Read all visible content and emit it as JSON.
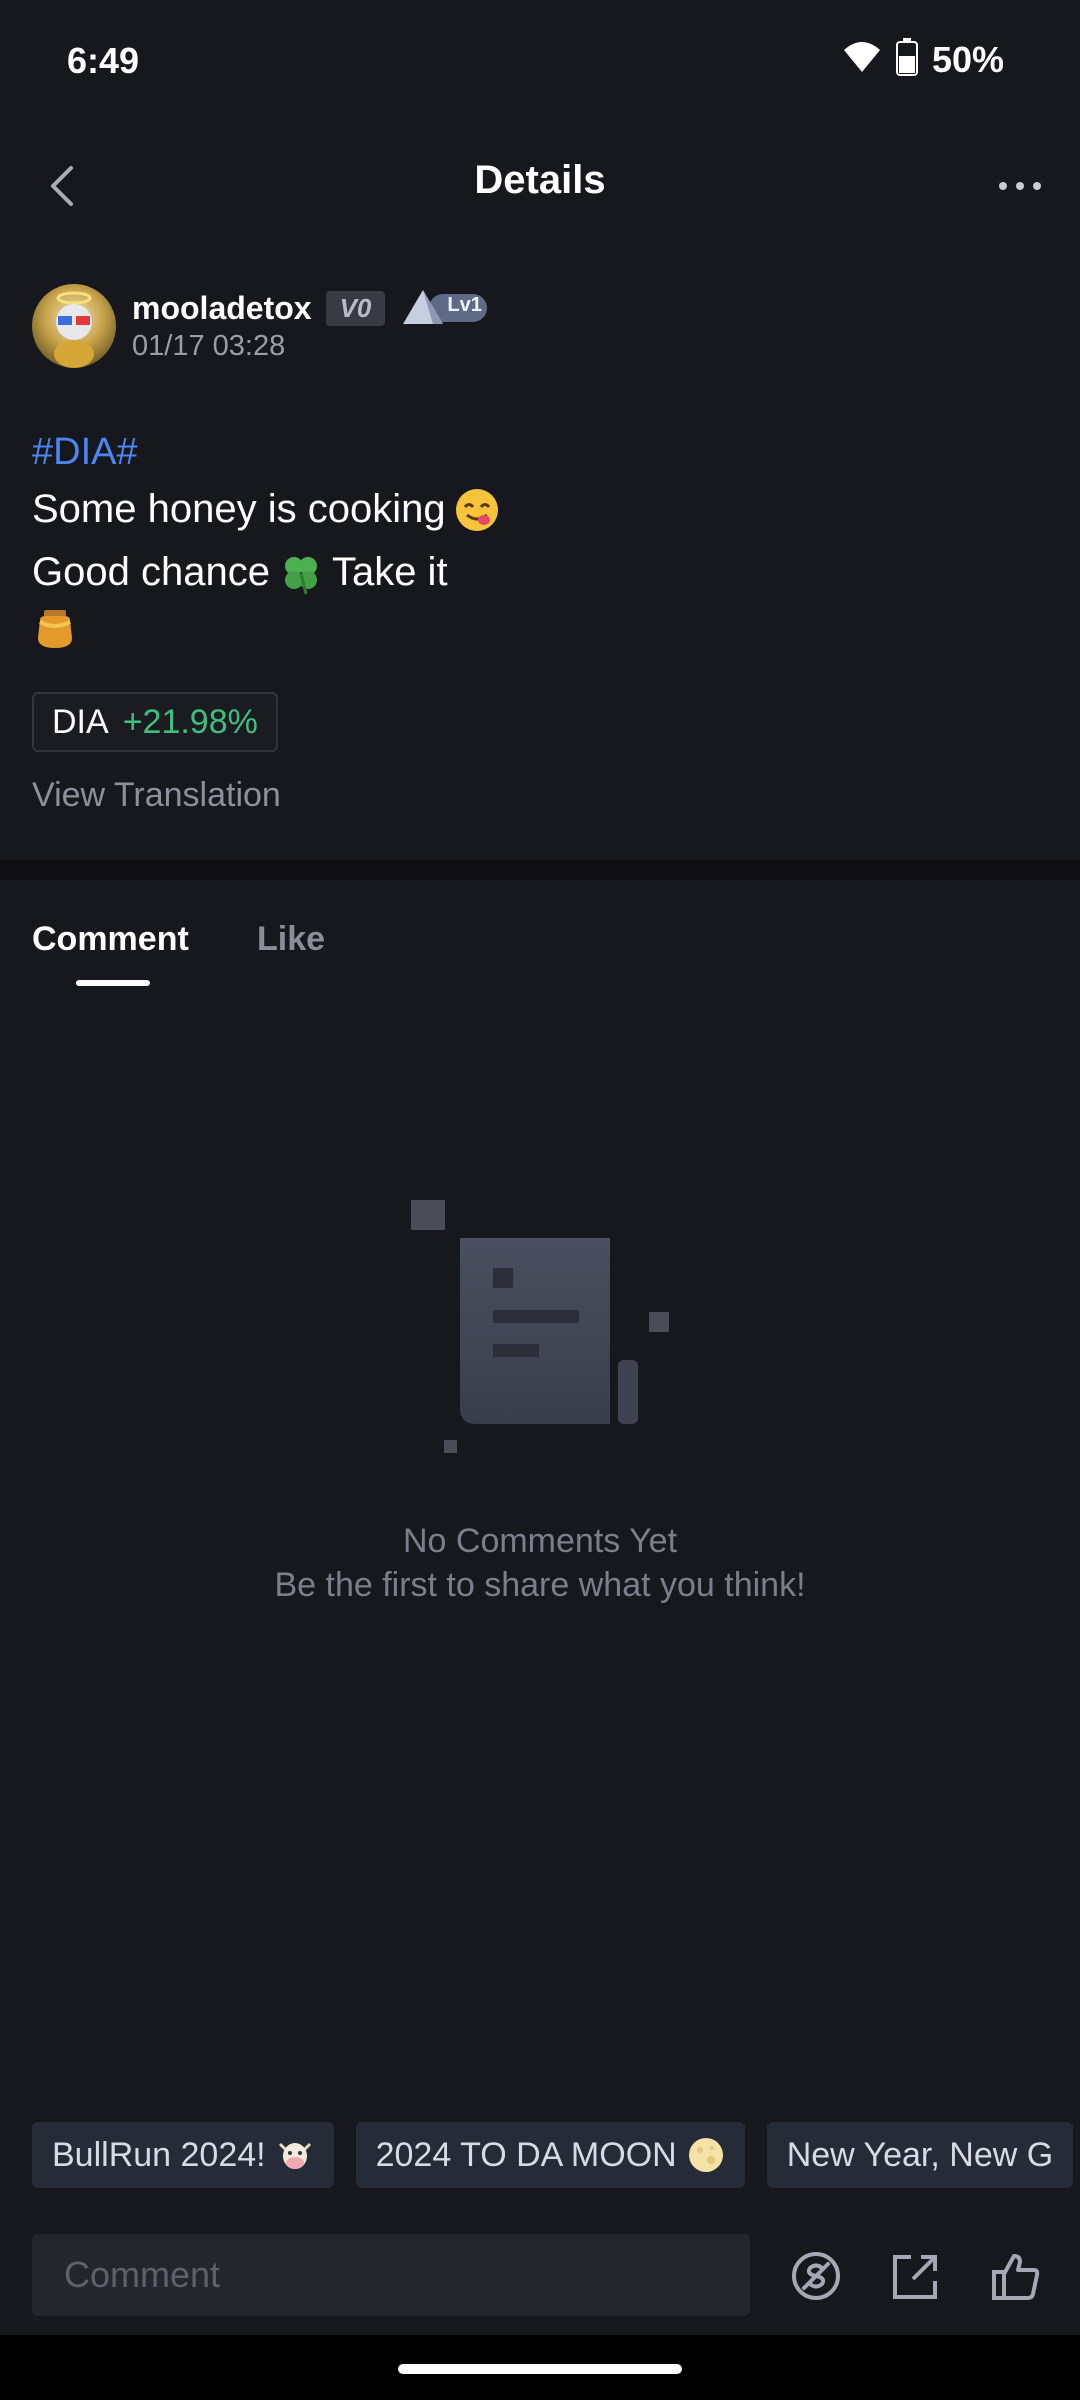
{
  "status_bar": {
    "time": "6:49",
    "battery": "50%"
  },
  "header": {
    "title": "Details"
  },
  "post": {
    "author": {
      "username": "mooladetox",
      "vip_label": "V0",
      "level_label": "Lv1",
      "time": "01/17 03:28"
    },
    "hashtag": "#DIA#",
    "lines": [
      "Some honey is cooking",
      "Good chance",
      "Take it"
    ],
    "emojis": [
      "yum-face",
      "four-leaf-clover",
      "honey-pot"
    ],
    "coin_tag": {
      "symbol": "DIA",
      "change": "+21.98%"
    },
    "view_translation": "View Translation"
  },
  "tabs": [
    {
      "label": "Comment",
      "active": true
    },
    {
      "label": "Like",
      "active": false
    }
  ],
  "empty_state": {
    "title": "No Comments Yet",
    "subtitle": "Be the first to share what you think!"
  },
  "topics": [
    {
      "label": "BullRun 2024!",
      "emoji": "cow-face"
    },
    {
      "label": "2024 TO DA MOON",
      "emoji": "full-moon"
    },
    {
      "label": "New Year, New G"
    }
  ],
  "bottom_bar": {
    "comment_placeholder": "Comment"
  },
  "colors": {
    "background": "#17171e",
    "hashtag": "#4d86f0",
    "positive": "#3fbf7f",
    "muted": "#8c909c"
  }
}
